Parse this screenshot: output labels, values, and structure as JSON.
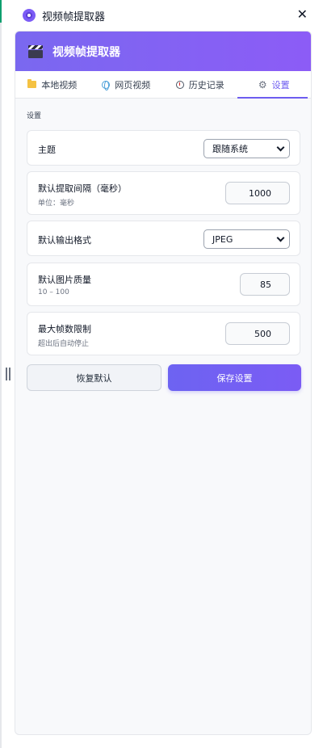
{
  "window": {
    "title": "视频帧提取器",
    "close_label": "✕"
  },
  "header": {
    "title": "视频帧提取器"
  },
  "tabs": [
    {
      "label": "本地视频",
      "icon": "folder-icon"
    },
    {
      "label": "网页视频",
      "icon": "globe-icon"
    },
    {
      "label": "历史记录",
      "icon": "clock-icon"
    },
    {
      "label": "设置",
      "icon": "gear-icon",
      "active": true
    }
  ],
  "settings": {
    "section_label": "设置",
    "theme": {
      "label": "主题",
      "value": "跟随系统"
    },
    "interval": {
      "label": "默认提取间隔（毫秒）",
      "hint": "单位：毫秒",
      "value": "1000"
    },
    "format": {
      "label": "默认输出格式",
      "value": "JPEG"
    },
    "quality": {
      "label": "默认图片质量",
      "hint": "10 – 100",
      "value": "85"
    },
    "max_frames": {
      "label": "最大帧数限制",
      "hint": "超出后自动停止",
      "value": "500"
    }
  },
  "actions": {
    "reset_label": "恢复默认",
    "save_label": "保存设置"
  },
  "colors": {
    "accent": "#6d5df0",
    "header_gradient_start": "#7a68f0",
    "header_gradient_end": "#8c5cf6"
  }
}
